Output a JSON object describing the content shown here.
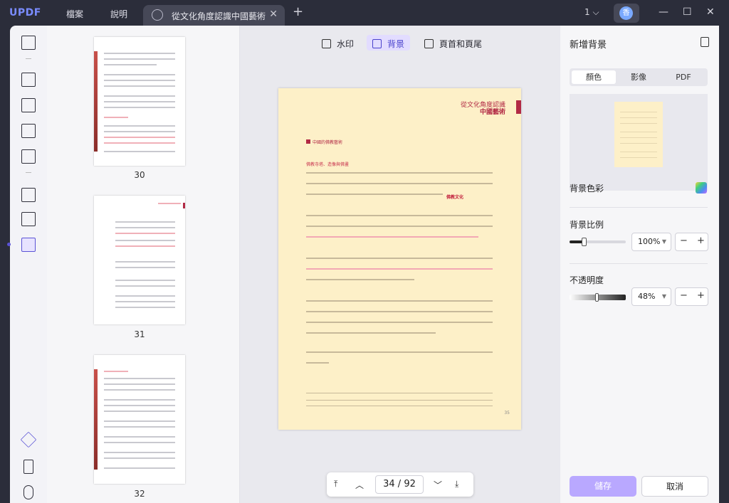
{
  "titlebar": {
    "logo": "UPDF",
    "menu": [
      "檔案",
      "說明"
    ],
    "tab_title": "從文化角度認識中國藝術",
    "page_indicator": "1",
    "avatar_initial": "香"
  },
  "toolbar": {
    "watermark": "水印",
    "background": "背景",
    "header_footer": "頁首和頁尾"
  },
  "thumbnails": [
    {
      "label": "30"
    },
    {
      "label": "31"
    },
    {
      "label": "32"
    }
  ],
  "document": {
    "header_line1": "從文化角度認識",
    "header_line2": "中國藝術",
    "section_title": "中國的佛教藝術",
    "subheading": "佛教寺塔、造像與佛畫",
    "stamp": "佛教文化",
    "page_number": "35"
  },
  "pager": {
    "current": "34",
    "separator": "/",
    "total": "92"
  },
  "right_panel": {
    "title": "新增背景",
    "tabs": [
      "顏色",
      "影像",
      "PDF"
    ],
    "active_tab": "顏色",
    "background_color_label": "背景色彩",
    "background_color": "#fdf0c8",
    "scale_label": "背景比例",
    "scale_value": "100%",
    "scale_fraction": 0.25,
    "opacity_label": "不透明度",
    "opacity_value": "48%",
    "opacity_fraction": 0.48,
    "save_label": "儲存",
    "cancel_label": "取消"
  },
  "colors": {
    "accent": "#5b53d6",
    "save_button": "#b9a8ff"
  }
}
